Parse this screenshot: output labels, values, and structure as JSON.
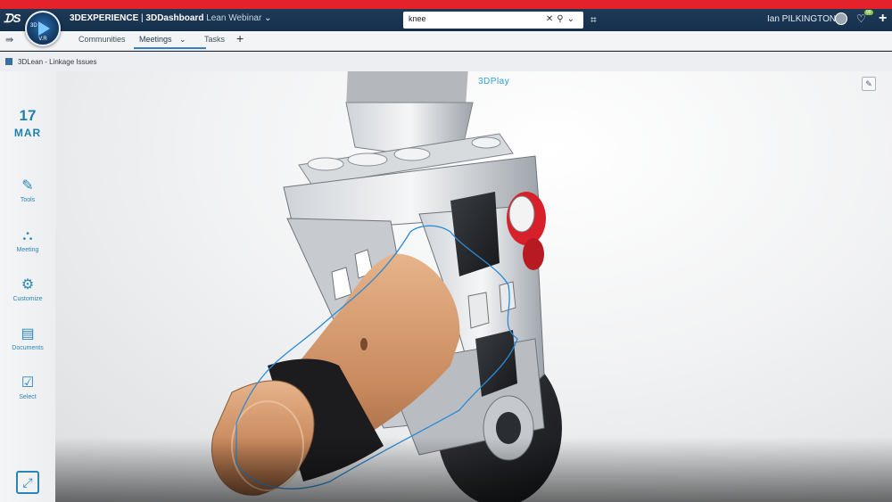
{
  "topbar": {
    "compass_label": "V.R",
    "compass_3d": "3D",
    "brand_app": "3DEXPERIENCE",
    "brand_sep": " | ",
    "brand_dashboard": "3DDashboard",
    "brand_sub": "Lean Webinar",
    "search_value": "knee",
    "user_name": "Ian PILKINGTON",
    "notif_count": "99"
  },
  "tabs": [
    {
      "label": "Communities"
    },
    {
      "label": "Meetings"
    },
    {
      "label": "Tasks"
    }
  ],
  "breadcrumb": {
    "title": "3DLean - Linkage Issues"
  },
  "sidebar": {
    "day": "17",
    "month": "MAR",
    "items": [
      {
        "label": "Tools",
        "icon": "tools-icon"
      },
      {
        "label": "Meeting",
        "icon": "meeting-icon"
      },
      {
        "label": "Customize",
        "icon": "gear-icon"
      },
      {
        "label": "Documents",
        "icon": "document-icon"
      },
      {
        "label": "Select",
        "icon": "select-icon"
      }
    ]
  },
  "viewer": {
    "title": "3DPlay"
  },
  "colors": {
    "accent": "#2a86b9",
    "topbar": "#1f3a57",
    "alert": "#e4222b",
    "part_red": "#d8202a",
    "skin": "#c98a5e"
  }
}
